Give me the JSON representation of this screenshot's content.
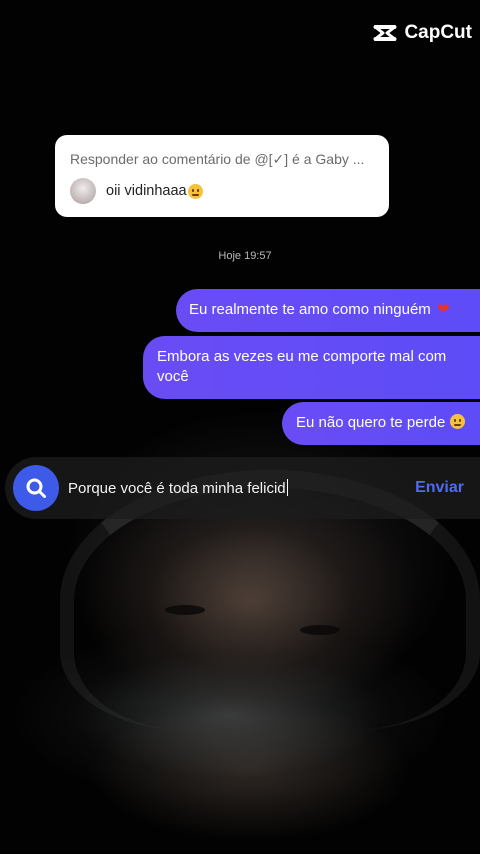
{
  "brand": {
    "name": "CapCut",
    "icon": "capcut-logo-icon"
  },
  "reply_card": {
    "title": "Responder ao comentário de @[✓] é a Gaby ...",
    "comment_text": "oii vidinhaaa",
    "comment_emoji": "smiling-face-with-tear-emoji"
  },
  "chat": {
    "timestamp": "Hoje 19:57",
    "messages": [
      {
        "text": "Eu realmente te amo como ninguém",
        "emoji": "heart-emoji"
      },
      {
        "text": "Embora as vezes eu me comporte mal com você",
        "emoji": ""
      },
      {
        "text": "Eu não quero te perde",
        "emoji": "pleading-face-emoji"
      }
    ]
  },
  "composer": {
    "icon": "search-icon",
    "value": "Porque você é toda minha felicid",
    "send_label": "Enviar"
  },
  "colors": {
    "bubble": "#6a4cf5",
    "search_button": "#3d5ae8",
    "send_text": "#4f6bf2",
    "reply_card_bg": "#ffffff"
  }
}
